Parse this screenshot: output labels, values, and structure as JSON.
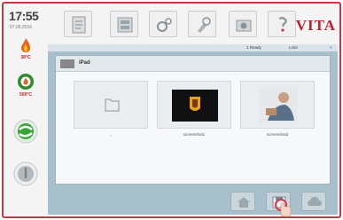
{
  "clock": {
    "time": "17:55",
    "date": "07.06.2016"
  },
  "sidebar": {
    "stat1": {
      "icon": "flame-icon",
      "label": "38°C",
      "color": "#e25c1c"
    },
    "stat2": {
      "icon": "heater-icon",
      "label": "500°C",
      "color": "#2e8b2e"
    },
    "buttons": [
      "sync-icon",
      "power-icon"
    ]
  },
  "toolbar": {
    "buttons": [
      "program-icon",
      "dryer-icon",
      "settings-icon",
      "tools-icon",
      "camera-icon",
      "help-icon"
    ],
    "brand": "VITA"
  },
  "statusbar": {
    "ready": "1 Ready",
    "label2": "Lolor"
  },
  "file_browser": {
    "path": "iPad",
    "items": [
      {
        "name": "..",
        "icon": "folder-icon"
      },
      {
        "name": "screenshot1",
        "icon": "image-thumb-dark"
      },
      {
        "name": "screenshot2",
        "icon": "image-thumb-person"
      }
    ]
  },
  "bottom_buttons": [
    "home-icon",
    "save-icon",
    "cloud-icon"
  ],
  "colors": {
    "frame": "#c23a4a",
    "panel": "#a8c0cc",
    "brand": "#c21e2e"
  }
}
